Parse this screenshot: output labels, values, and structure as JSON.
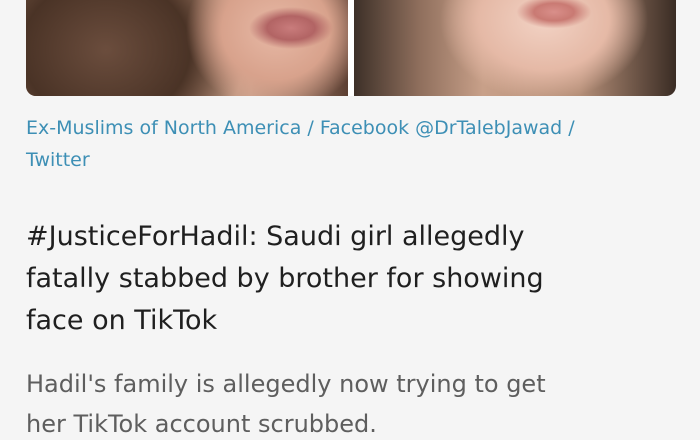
{
  "article": {
    "image_alt": "Photo of Hadil",
    "caption_line1": "Ex-Muslims of North America / Facebook @DrTalebJawad /",
    "caption_line2": "Twitter",
    "headline_line1": "#JusticeForHadil: Saudi girl allegedly",
    "headline_line2": "fatally stabbed by brother for showing",
    "headline_line3": "face on TikTok",
    "summary_line1": "Hadil's family is allegedly now trying to get",
    "summary_line2": "her TikTok account scrubbed."
  },
  "colors": {
    "caption_link": "#3d8fb5",
    "headline_text": "#1f1f1f",
    "summary_text": "#5e5e5e",
    "background": "#f5f5f5"
  }
}
